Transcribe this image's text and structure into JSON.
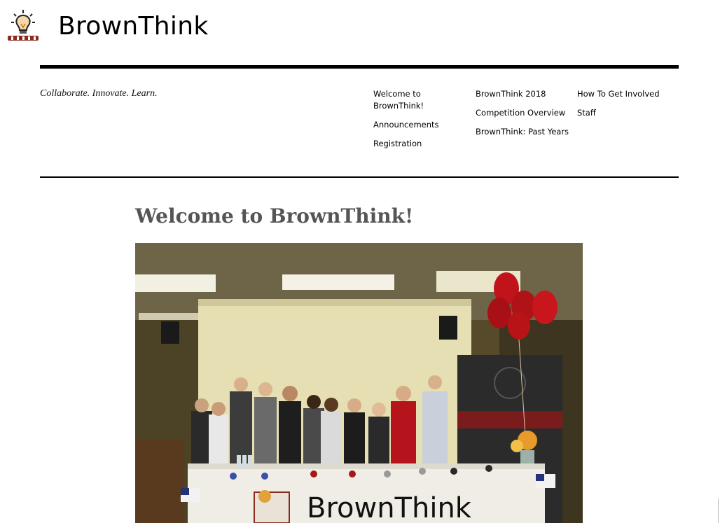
{
  "site": {
    "title": "BrownThink",
    "tagline": "Collaborate. Innovate. Learn.",
    "logo_icon": "lightbulb-icon"
  },
  "nav": {
    "col1": [
      "Welcome to BrownThink!",
      "Announcements",
      "Registration"
    ],
    "col2": [
      "BrownThink 2018",
      "Competition Overview",
      "BrownThink: Past Years"
    ],
    "col3": [
      "How To Get Involved",
      "Staff"
    ]
  },
  "page": {
    "heading": "Welcome to BrownThink!",
    "photo_banner_text": "BrownThink"
  },
  "colors": {
    "accent": "#000000",
    "heading": "#555555",
    "balloon_red": "#c0141a"
  }
}
